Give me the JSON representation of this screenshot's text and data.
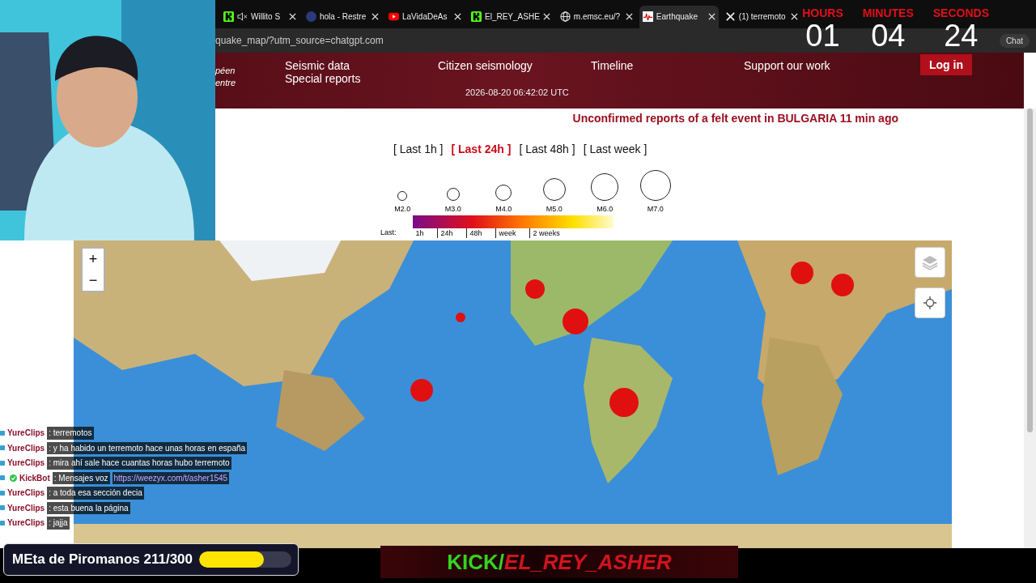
{
  "browser": {
    "tabs": [
      {
        "label": "Willito S",
        "kind": "kick",
        "muted": true,
        "selected": false
      },
      {
        "label": "hola - Restre",
        "kind": "circle",
        "muted": false,
        "selected": false
      },
      {
        "label": "LaVidaDeAs",
        "kind": "video",
        "muted": false,
        "selected": false
      },
      {
        "label": "El_REY_ASHE",
        "kind": "kick",
        "muted": false,
        "selected": false
      },
      {
        "label": "m.emsc.eu/?",
        "kind": "globe",
        "muted": false,
        "selected": false
      },
      {
        "label": "Earthquake",
        "kind": "quake",
        "muted": false,
        "selected": true
      },
      {
        "label": "(1) terremoto",
        "kind": "x",
        "muted": false,
        "selected": false
      }
    ],
    "address": "quake_map/?utm_source=chatgpt.com",
    "right_button": "Chat"
  },
  "header": {
    "logo_fragments": [
      "péen",
      "entre"
    ],
    "nav_columns": [
      [
        "Seismic data",
        "Special reports"
      ],
      [
        "Citizen seismology"
      ],
      [
        "Timeline"
      ],
      [
        "Support our work"
      ]
    ],
    "timestamp": "2026-08-20 06:42:02 UTC",
    "login": "Log in"
  },
  "alert": "Unconfirmed reports of a felt event in BULGARIA 11 min ago",
  "time_filters": [
    {
      "label": "[ Last 1h ]",
      "selected": false
    },
    {
      "label": "[ Last 24h ]",
      "selected": true
    },
    {
      "label": "[ Last 48h ]",
      "selected": false
    },
    {
      "label": "[ Last week ]",
      "selected": false
    }
  ],
  "legend": {
    "magnitudes": [
      "M2.0",
      "M3.0",
      "M4.0",
      "M5.0",
      "M6.0",
      "M7.0"
    ],
    "last_label": "Last:",
    "periods": [
      "1h",
      "24h",
      "48h",
      "week",
      "2 weeks"
    ]
  },
  "map": {
    "zoom_in": "+",
    "zoom_out": "−"
  },
  "overlays": {
    "timer": [
      {
        "label": "HOURS",
        "value": "01"
      },
      {
        "label": "MINUTES",
        "value": "04"
      },
      {
        "label": "SECONDS",
        "value": "24"
      }
    ],
    "chat": [
      {
        "user": "YureClips",
        "verified": false,
        "message": ": terremotos"
      },
      {
        "user": "YureClips",
        "verified": false,
        "message": ": y ha habido un terremoto hace unas horas en españa"
      },
      {
        "user": "YureClips",
        "verified": false,
        "message": ": mira ahí sale hace cuantas horas hubo terremoto"
      },
      {
        "user": "KickBot",
        "verified": true,
        "message": ": Mensajes voz",
        "link": "https://weezyx.com/t/asher1545"
      },
      {
        "user": "YureClips",
        "verified": false,
        "message": ": a toda esa sección decia"
      },
      {
        "user": "YureClips",
        "verified": false,
        "message": ": esta buena la página"
      },
      {
        "user": "YureClips",
        "verified": false,
        "message": ": jajja"
      }
    ],
    "goal": {
      "text": "MEta de Piromanos 211/300",
      "level": 0.7
    },
    "banner": {
      "site": "KICK/",
      "channel": "EL_REY_ASHER"
    }
  }
}
